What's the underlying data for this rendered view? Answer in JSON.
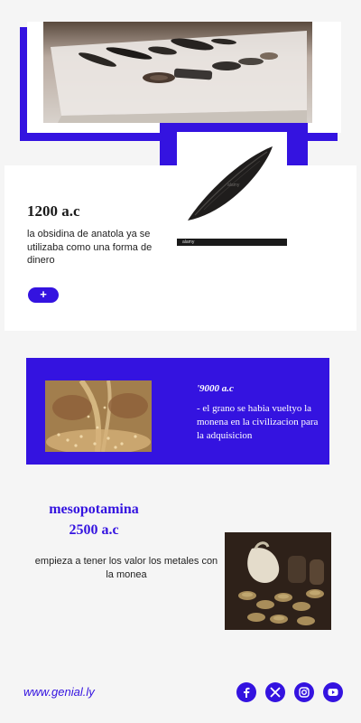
{
  "section1": {
    "date": "1200 a.c",
    "description": "la obsidina de anatola ya se utilizaba como una forma de dinero",
    "plus_label": "+",
    "photo_caption": "alamy"
  },
  "section2": {
    "date": "'9000 a.c",
    "description": "- el grano se habia vueltyo la monena en la civilizacion para la adquisicion"
  },
  "section3": {
    "title": "mesopotamina",
    "date": "2500 a.c",
    "description": "empieza a tener los valor los metales con la monea"
  },
  "footer": {
    "link": "www.genial.ly",
    "social_icons": [
      "facebook-icon",
      "x-icon",
      "instagram-icon",
      "youtube-icon"
    ]
  },
  "colors": {
    "accent": "#3413e0",
    "panel": "#ffffff",
    "background": "#f5f5f5"
  }
}
